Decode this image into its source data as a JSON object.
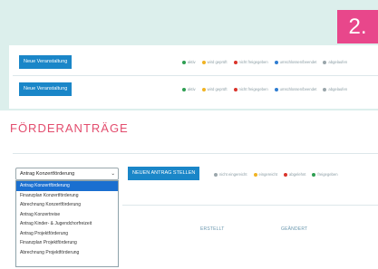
{
  "step_badge": "2.",
  "top_rows": [
    {
      "button": "Neue Veranstaltung",
      "legend": [
        {
          "label": "aktiv",
          "color": "#2e9e52"
        },
        {
          "label": "wird geprüft",
          "color": "#f0b323"
        },
        {
          "label": "nicht freigegeben",
          "color": "#d9342b"
        },
        {
          "label": "umschlossen/beendet",
          "color": "#2f7dd1"
        },
        {
          "label": "abgelaufen",
          "color": "#9aa6ab"
        }
      ]
    },
    {
      "button": "Neue Veranstaltung",
      "legend": [
        {
          "label": "aktiv",
          "color": "#2e9e52"
        },
        {
          "label": "wird geprüft",
          "color": "#f0b323"
        },
        {
          "label": "nicht freigegeben",
          "color": "#d9342b"
        },
        {
          "label": "umschlossen/beendet",
          "color": "#2f7dd1"
        },
        {
          "label": "abgelaufen",
          "color": "#9aa6ab"
        }
      ]
    }
  ],
  "section": {
    "title": "FÖRDERANTRÄGE",
    "select_value": "Antrag Konzertförderung",
    "new_request_button": "NEUEN ANTRAG STELLEN",
    "legend": [
      {
        "label": "nicht eingereicht",
        "color": "#9aa6ab"
      },
      {
        "label": "eingereicht",
        "color": "#f0b323"
      },
      {
        "label": "abgelehnt",
        "color": "#d9342b"
      },
      {
        "label": "freigegeben",
        "color": "#2e9e52"
      }
    ],
    "dropdown_options": [
      "Antrag Konzertförderung",
      "Finanzplan Konzertförderung",
      "Abrechnung Konzertförderung",
      "Antrag Konzertreise",
      "Antrag Kinder- & Jugendchorfreizeit",
      "Antrag Projektförderung",
      "Finanzplan Projektförderung",
      "Abrechnung Projektförderung"
    ],
    "selected_option_index": 0,
    "columns": [
      "ERSTELLT",
      "GEÄNDERT"
    ]
  }
}
